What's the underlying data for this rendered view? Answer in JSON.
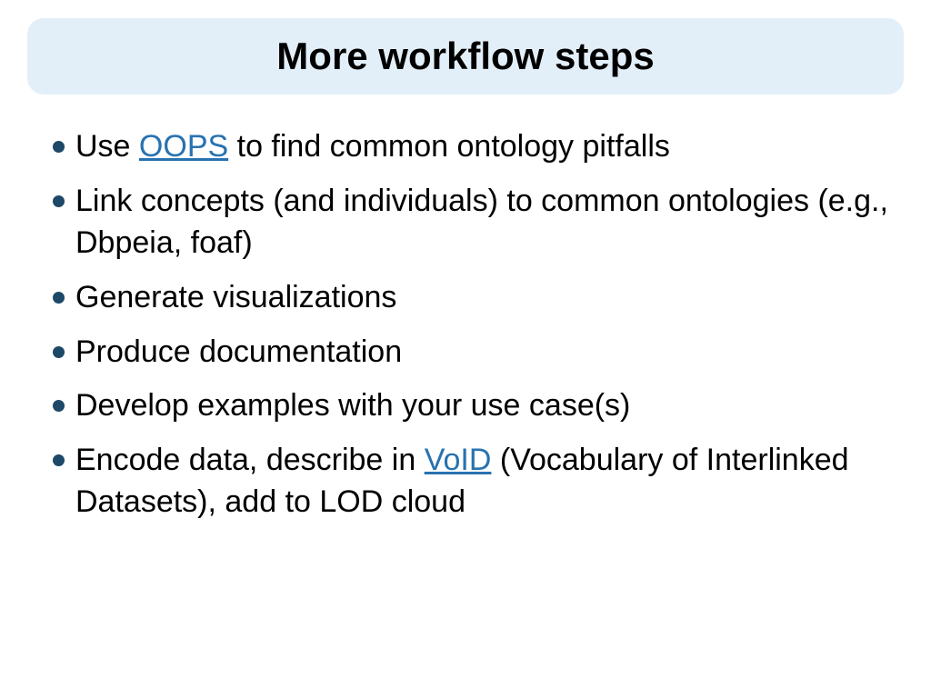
{
  "title": "More workflow steps",
  "bullets": {
    "b1_pre": "Use ",
    "b1_link": "OOPS",
    "b1_post": " to find common ontology pitfalls",
    "b2": "Link concepts (and individuals) to common ontologies (e.g., Dbpeia, foaf)",
    "b3": "Generate visualizations",
    "b4": "Produce documentation",
    "b5": "Develop examples with your use case(s)",
    "b6_pre": "Encode data, describe in ",
    "b6_link": "VoID",
    "b6_post": " (Vocabulary of Interlinked Datasets),  add to LOD cloud"
  }
}
